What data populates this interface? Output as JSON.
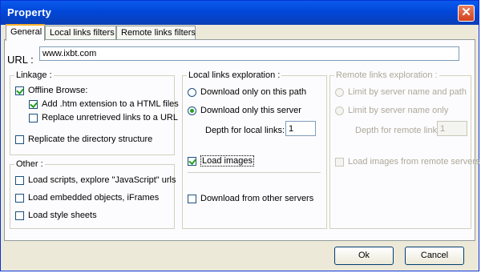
{
  "window": {
    "title": "Property",
    "close_glyph": "✕"
  },
  "tabs": [
    {
      "label": "General",
      "active": true
    },
    {
      "label": "Local links filters",
      "active": false
    },
    {
      "label": "Remote links filters",
      "active": false
    }
  ],
  "url": {
    "label": "URL :",
    "value": "www.ixbt.com"
  },
  "linkage": {
    "legend": "Linkage :",
    "offline_browse": {
      "label": "Offline Browse:",
      "checked": true
    },
    "add_htm": {
      "label": "Add .htm extension to a HTML files",
      "checked": true
    },
    "replace_unretrieved": {
      "label": "Replace unretrieved  links to a URL",
      "checked": false
    },
    "replicate_dir": {
      "label": "Replicate the directory structure",
      "checked": false
    }
  },
  "other": {
    "legend": "Other :",
    "load_scripts": {
      "label": "Load scripts, explore \"JavaScript\" urls",
      "checked": false
    },
    "load_embedded": {
      "label": "Load embedded objects,  iFrames",
      "checked": false
    },
    "load_styles": {
      "label": "Load style sheets",
      "checked": false
    }
  },
  "local_links": {
    "legend": "Local links exploration :",
    "download_path": {
      "label": "Download only on this path",
      "selected": false
    },
    "download_server": {
      "label": "Download only this server",
      "selected": true
    },
    "depth_label": "Depth for local links:",
    "depth_value": "1",
    "load_images": {
      "label": "Load images",
      "checked": true
    },
    "download_other": {
      "label": "Download from other servers",
      "checked": false
    }
  },
  "remote_links": {
    "legend": "Remote links exploration :",
    "limit_name_path": {
      "label": "Limit by server name and path",
      "selected": false
    },
    "limit_name_only": {
      "label": "Limit by server name only",
      "selected": false
    },
    "depth_label": "Depth for remote links:",
    "depth_value": "1",
    "load_remote_images": {
      "label": "Load images from remote servers",
      "checked": false
    }
  },
  "buttons": {
    "ok": "Ok",
    "cancel": "Cancel"
  },
  "colors": {
    "titlebar": "#0a5bec",
    "dialog_bg": "#ece9d8",
    "check": "#21a121",
    "tab_highlight": "#f7b02b"
  }
}
